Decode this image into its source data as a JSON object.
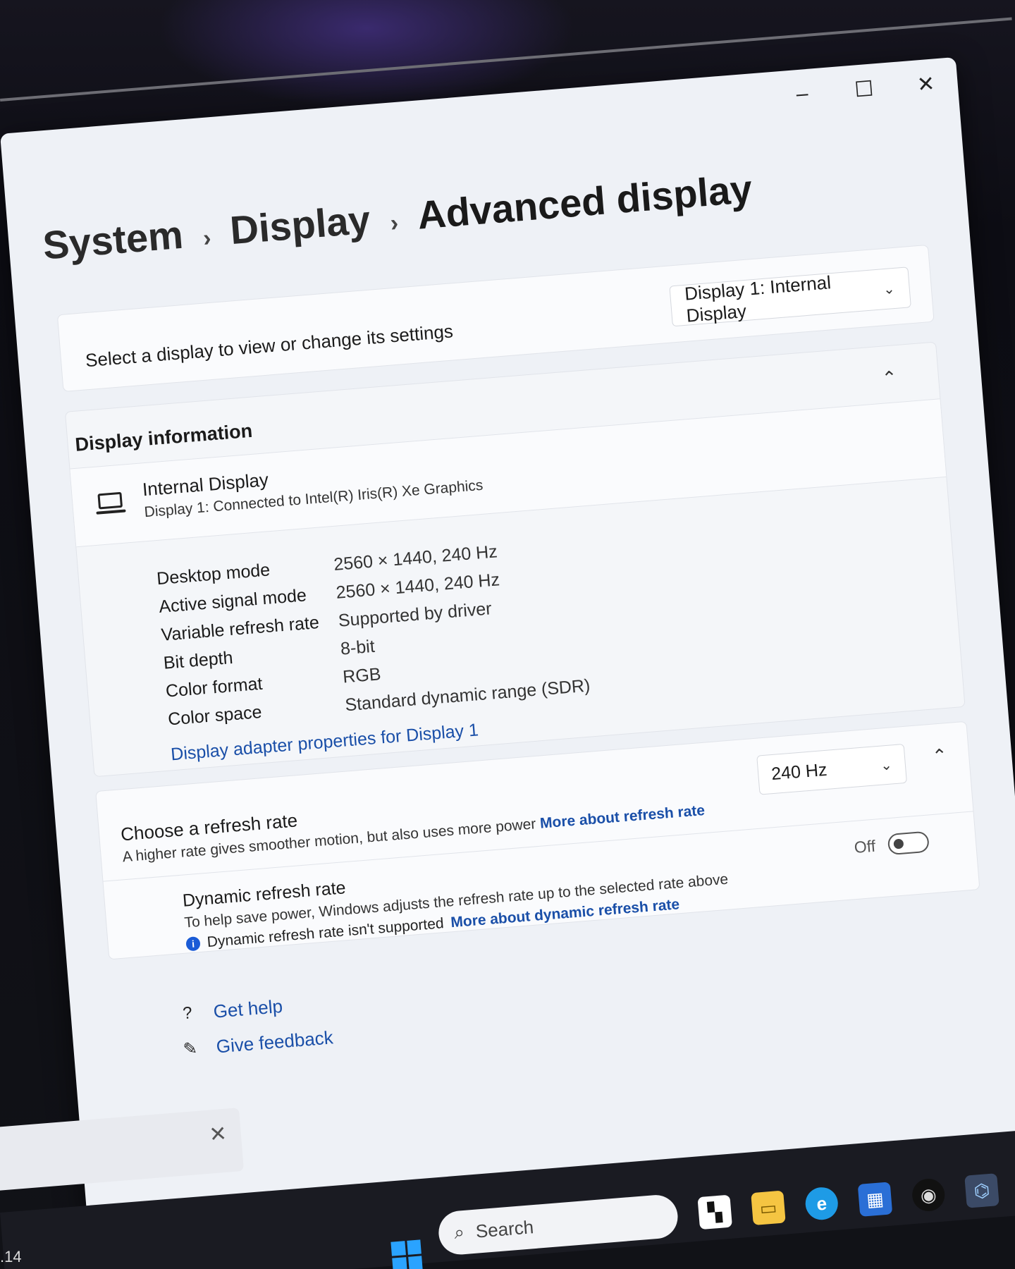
{
  "window": {
    "controls": {
      "minimize": "–",
      "maximize": "☐",
      "close": "✕"
    }
  },
  "breadcrumb": {
    "items": [
      "System",
      "Display",
      "Advanced display"
    ],
    "separator": "›"
  },
  "display_select": {
    "label": "Select a display to view or change its settings",
    "selected": "Display 1: Internal Display",
    "chevron": "⌄"
  },
  "display_info": {
    "heading": "Display information",
    "collapse_glyph": "⌃",
    "name": "Internal Display",
    "connection": "Display 1: Connected to Intel(R) Iris(R) Xe Graphics",
    "specs": [
      {
        "key": "Desktop mode",
        "value": "2560 × 1440, 240 Hz"
      },
      {
        "key": "Active signal mode",
        "value": "2560 × 1440, 240 Hz"
      },
      {
        "key": "Variable refresh rate",
        "value": "Supported by driver"
      },
      {
        "key": "Bit depth",
        "value": "8-bit"
      },
      {
        "key": "Color format",
        "value": "RGB"
      },
      {
        "key": "Color space",
        "value": "Standard dynamic range (SDR)"
      }
    ],
    "adapter_link": "Display adapter properties for Display 1"
  },
  "refresh": {
    "title": "Choose a refresh rate",
    "description": "A higher rate gives smoother motion, but also uses more power",
    "more_link": "More about refresh rate",
    "selected_rate": "240 Hz",
    "collapse_glyph": "⌃",
    "dynamic": {
      "title": "Dynamic refresh rate",
      "description": "To help save power, Windows adjusts the refresh rate up to the selected rate above",
      "note": "Dynamic refresh rate isn't supported",
      "more_link": "More about dynamic refresh rate",
      "toggle_state": "Off"
    }
  },
  "help": {
    "get_help": "Get help",
    "give_feedback": "Give feedback"
  },
  "taskbar": {
    "search_placeholder": "Search",
    "clock_fragment": ".14",
    "tab_close": "✕"
  }
}
